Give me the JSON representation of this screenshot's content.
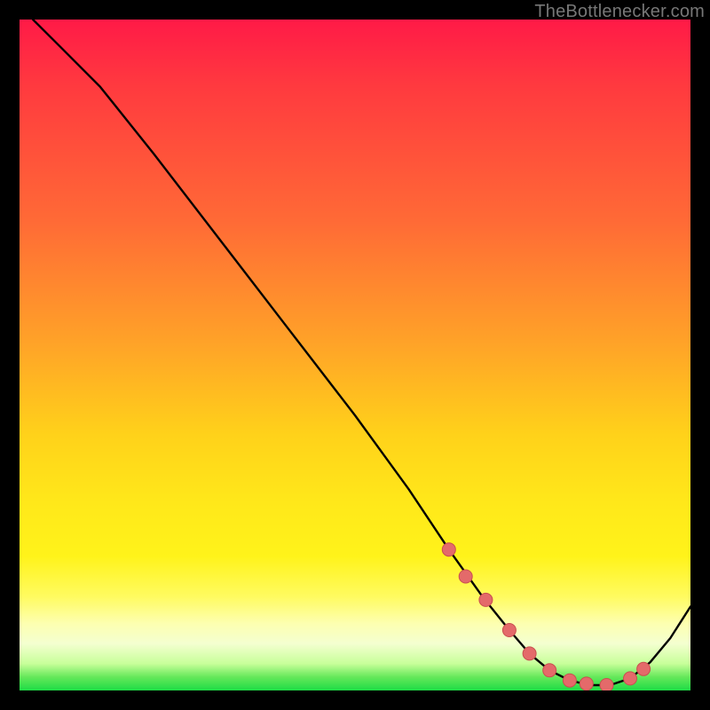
{
  "watermark": "TheBottlenecker.com",
  "colors": {
    "page_bg": "#000000",
    "curve": "#000000",
    "marker_fill": "#e46a6a",
    "marker_stroke": "#c94f4f"
  },
  "chart_data": {
    "type": "line",
    "title": "",
    "xlabel": "",
    "ylabel": "",
    "xlim": [
      0,
      100
    ],
    "ylim": [
      0,
      100
    ],
    "grid": false,
    "legend": false,
    "series": [
      {
        "name": "curve",
        "x": [
          2,
          6,
          12,
          20,
          30,
          40,
          50,
          58,
          64,
          69,
          73,
          76,
          79,
          82,
          85,
          88,
          91,
          94,
          97,
          100
        ],
        "values": [
          100,
          96,
          90,
          80,
          67,
          54,
          41,
          30,
          21,
          14,
          9,
          5.5,
          3,
          1.5,
          0.8,
          0.8,
          1.8,
          4.2,
          7.8,
          12.5
        ]
      }
    ],
    "markers": {
      "name": "highlighted-points",
      "x": [
        64,
        66.5,
        69.5,
        73,
        76,
        79,
        82,
        84.5,
        87.5,
        91,
        93
      ],
      "values": [
        21,
        17,
        13.5,
        9,
        5.5,
        3,
        1.5,
        1.0,
        0.8,
        1.8,
        3.2
      ]
    },
    "gradient_stops": [
      {
        "pos": 0.0,
        "color": "#ff1a47"
      },
      {
        "pos": 0.3,
        "color": "#ff6a36"
      },
      {
        "pos": 0.62,
        "color": "#ffd21a"
      },
      {
        "pos": 0.9,
        "color": "#fdffb0"
      },
      {
        "pos": 1.0,
        "color": "#1edc46"
      }
    ]
  }
}
